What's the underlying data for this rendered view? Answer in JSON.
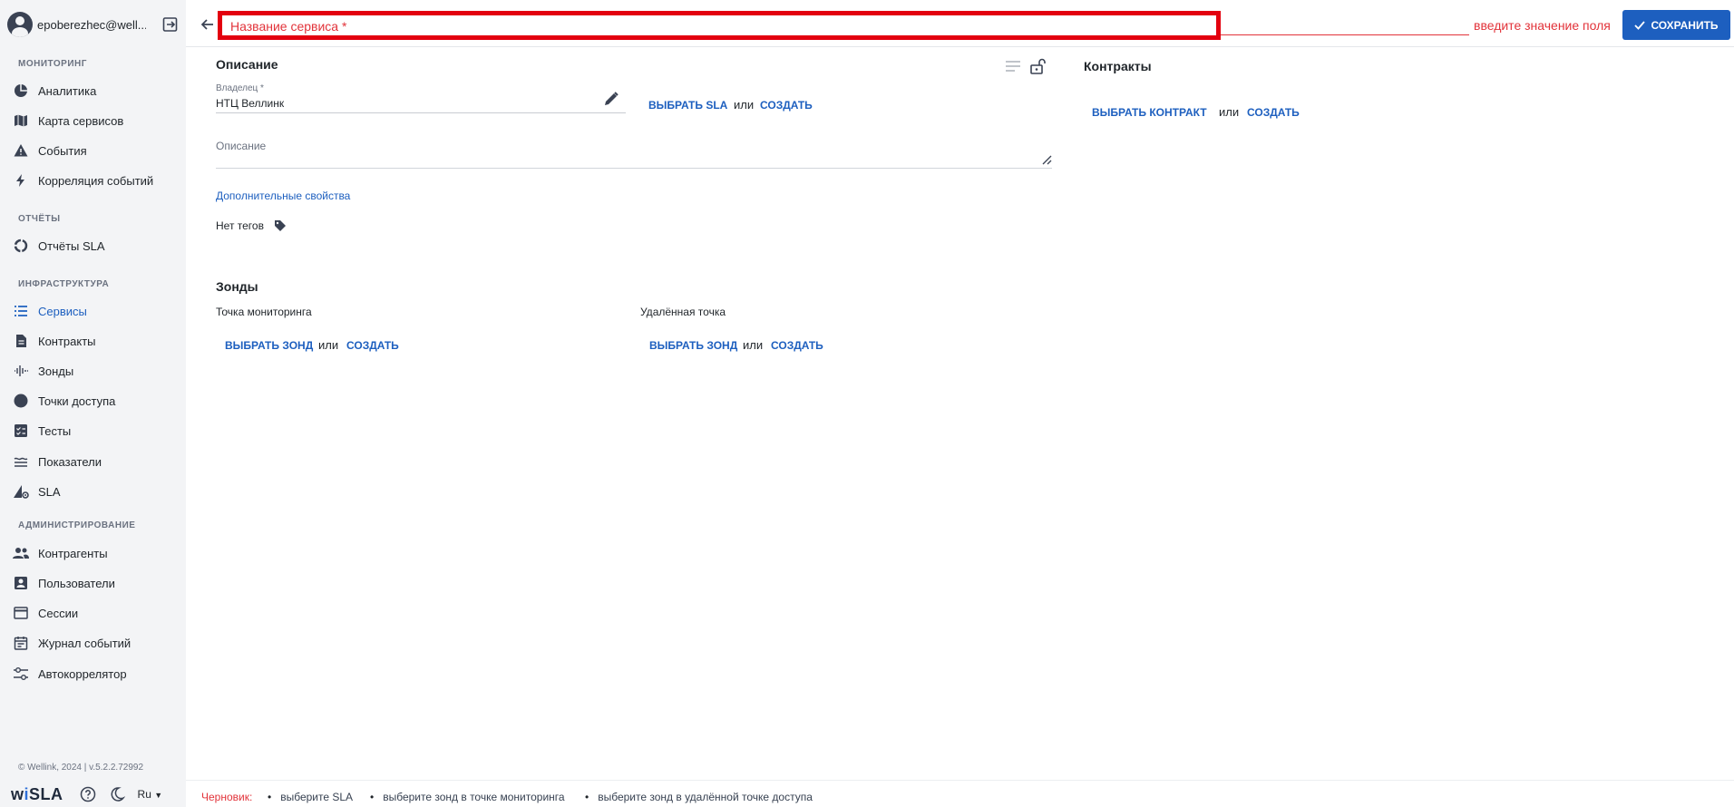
{
  "user": {
    "name": "epoberezhec@well..."
  },
  "sidebar": {
    "sections": [
      {
        "title": "МОНИТОРИНГ",
        "items": [
          {
            "label": "Аналитика",
            "icon": "analytics-pie-icon"
          },
          {
            "label": "Карта сервисов",
            "icon": "map-icon"
          },
          {
            "label": "События",
            "icon": "warning-icon"
          },
          {
            "label": "Корреляция событий",
            "icon": "bolt-icon"
          }
        ]
      },
      {
        "title": "ОТЧЁТЫ",
        "items": [
          {
            "label": "Отчёты SLA",
            "icon": "sla-report-icon"
          }
        ]
      },
      {
        "title": "ИНФРАСТРУКТУРА",
        "items": [
          {
            "label": "Сервисы",
            "icon": "list-icon",
            "active": true
          },
          {
            "label": "Контракты",
            "icon": "document-icon"
          },
          {
            "label": "Зонды",
            "icon": "probe-icon"
          },
          {
            "label": "Точки доступа",
            "icon": "access-point-icon"
          },
          {
            "label": "Тесты",
            "icon": "checklist-icon"
          },
          {
            "label": "Показатели",
            "icon": "metrics-icon"
          },
          {
            "label": "SLA",
            "icon": "sla-icon"
          }
        ]
      },
      {
        "title": "АДМИНИСТРИРОВАНИЕ",
        "items": [
          {
            "label": "Контрагенты",
            "icon": "people-icon"
          },
          {
            "label": "Пользователи",
            "icon": "user-card-icon"
          },
          {
            "label": "Сессии",
            "icon": "sessions-icon"
          },
          {
            "label": "Журнал событий",
            "icon": "calendar-icon"
          },
          {
            "label": "Автокоррелятор",
            "icon": "sliders-icon"
          }
        ]
      }
    ],
    "copyright": "© Wellink, 2024 | v.5.2.2.72992",
    "brand": "wiSLA",
    "language": "Ru"
  },
  "header": {
    "title_placeholder": "Название сервиса *",
    "error": "введите значение поля",
    "save_label": "СОХРАНИТЬ"
  },
  "description": {
    "heading": "Описание",
    "owner_label": "Владелец *",
    "owner_value": "НТЦ Веллинк",
    "select_sla": "ВЫБРАТЬ SLA",
    "or": "или",
    "create": "СОЗДАТЬ",
    "description_label": "Описание",
    "extra_props": "Дополнительные свойства",
    "no_tags": "Нет тегов"
  },
  "zones": {
    "heading": "Зонды",
    "monitoring_point": "Точка мониторинга",
    "remote_point": "Удалённая точка",
    "select_zone": "ВЫБРАТЬ ЗОНД",
    "or": "или",
    "create": "СОЗДАТЬ"
  },
  "contracts": {
    "heading": "Контракты",
    "select_contract": "ВЫБРАТЬ КОНТРАКТ",
    "or": "или",
    "create": "СОЗДАТЬ"
  },
  "draft": {
    "label": "Черновик:",
    "items": [
      "выберите SLA",
      "выберите зонд в точке мониторинга",
      "выберите зонд в удалённой точке доступа"
    ]
  },
  "colors": {
    "accent": "#1d5fbf",
    "error": "#e2333a",
    "highlight_box": "#e3000f"
  }
}
